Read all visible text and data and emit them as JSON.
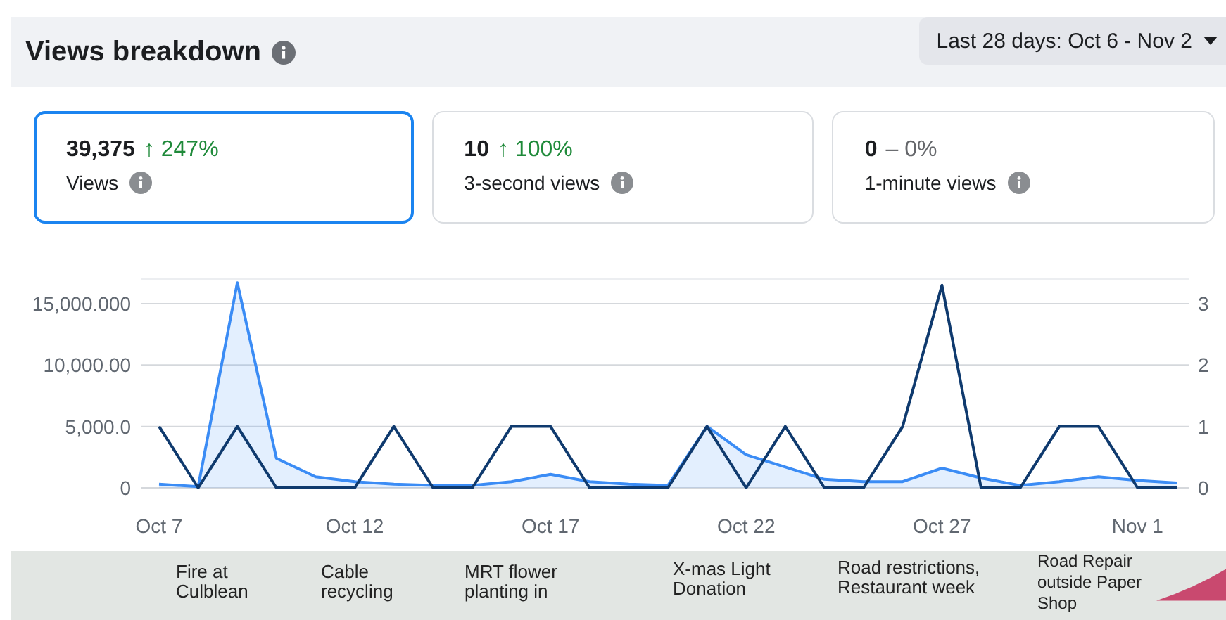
{
  "header": {
    "title": "Views breakdown",
    "date_range": "Last 28 days: Oct 6 - Nov 2"
  },
  "metrics": [
    {
      "value": "39,375",
      "change_arrow": "↑",
      "change": "247%",
      "color": "#1f8a3a",
      "label": "Views",
      "selected": true
    },
    {
      "value": "10",
      "change_arrow": "↑",
      "change": "100%",
      "color": "#1f8a3a",
      "label": "3-second views",
      "selected": false
    },
    {
      "value": "0",
      "change_arrow": "–",
      "change": "0%",
      "color": "#65676b",
      "label": "1-minute views",
      "selected": false
    }
  ],
  "chart": {
    "chart_data": {
      "type": "line",
      "categories": [
        "Oct 7",
        null,
        null,
        null,
        null,
        "Oct 12",
        null,
        null,
        null,
        null,
        "Oct 17",
        null,
        null,
        null,
        null,
        "Oct 22",
        null,
        null,
        null,
        null,
        "Oct 27",
        null,
        null,
        null,
        null,
        "Nov 1",
        null
      ],
      "series": [
        {
          "color": "#3b8cf5",
          "axis": "y",
          "type": "area",
          "values": [
            300,
            100,
            16700,
            2400,
            900,
            500,
            300,
            200,
            200,
            500,
            1100,
            500,
            300,
            200,
            5000,
            2700,
            1700,
            700,
            500,
            500,
            1600,
            800,
            200,
            500,
            900,
            600,
            400
          ]
        },
        {
          "color": "#0f3a6e",
          "axis": "y2",
          "values": [
            1,
            0,
            1,
            0,
            0,
            0,
            1,
            0,
            0,
            1,
            1,
            0,
            0,
            0,
            1,
            0,
            1,
            0,
            0,
            1,
            3.3,
            0,
            0,
            1,
            1,
            0,
            0
          ]
        }
      ],
      "grid": true,
      "ylim": [
        0,
        17000
      ],
      "y2lim": [
        0,
        3.4
      ],
      "yticks": [
        {
          "value": 0,
          "label": "0"
        },
        {
          "value": 5000,
          "label": "5,000.0"
        },
        {
          "value": 10000,
          "label": "10,000.00"
        },
        {
          "value": 15000,
          "label": "15,000.000"
        }
      ],
      "y2ticks": [
        0,
        1,
        2,
        3
      ]
    }
  },
  "event_notes": [
    "Fire at Culblean",
    "Cable recycling",
    "MRT flower planting in",
    "X-mas Light Donation",
    "Road restrictions, Restaurant week",
    "Road Repair outside Paper Shop"
  ]
}
